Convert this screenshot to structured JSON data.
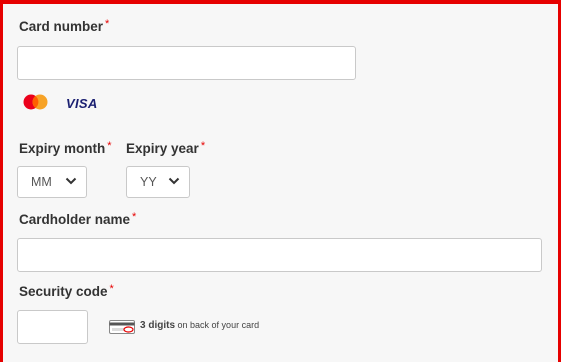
{
  "form": {
    "card_number": {
      "label": "Card number",
      "required_mark": "*",
      "value": ""
    },
    "card_brands": [
      "mastercard",
      "visa"
    ],
    "visa_text": "VISA",
    "expiry_month": {
      "label": "Expiry month",
      "required_mark": "*",
      "selected": "MM"
    },
    "expiry_year": {
      "label": "Expiry year",
      "required_mark": "*",
      "selected": "YY"
    },
    "cardholder_name": {
      "label": "Cardholder name",
      "required_mark": "*",
      "value": ""
    },
    "security_code": {
      "label": "Security code",
      "required_mark": "*",
      "value": "",
      "hint_bold": "3 digits",
      "hint_rest": "on back of your card"
    }
  },
  "colors": {
    "accent_red": "#e60000",
    "label_text": "#333333",
    "background": "#f7f7f7",
    "visa_blue": "#1a1f71",
    "mastercard_red": "#eb001b",
    "mastercard_orange": "#f79e1b"
  },
  "icons": {
    "select_arrow": "chevron-down-icon",
    "cvv": "card-back-icon"
  }
}
